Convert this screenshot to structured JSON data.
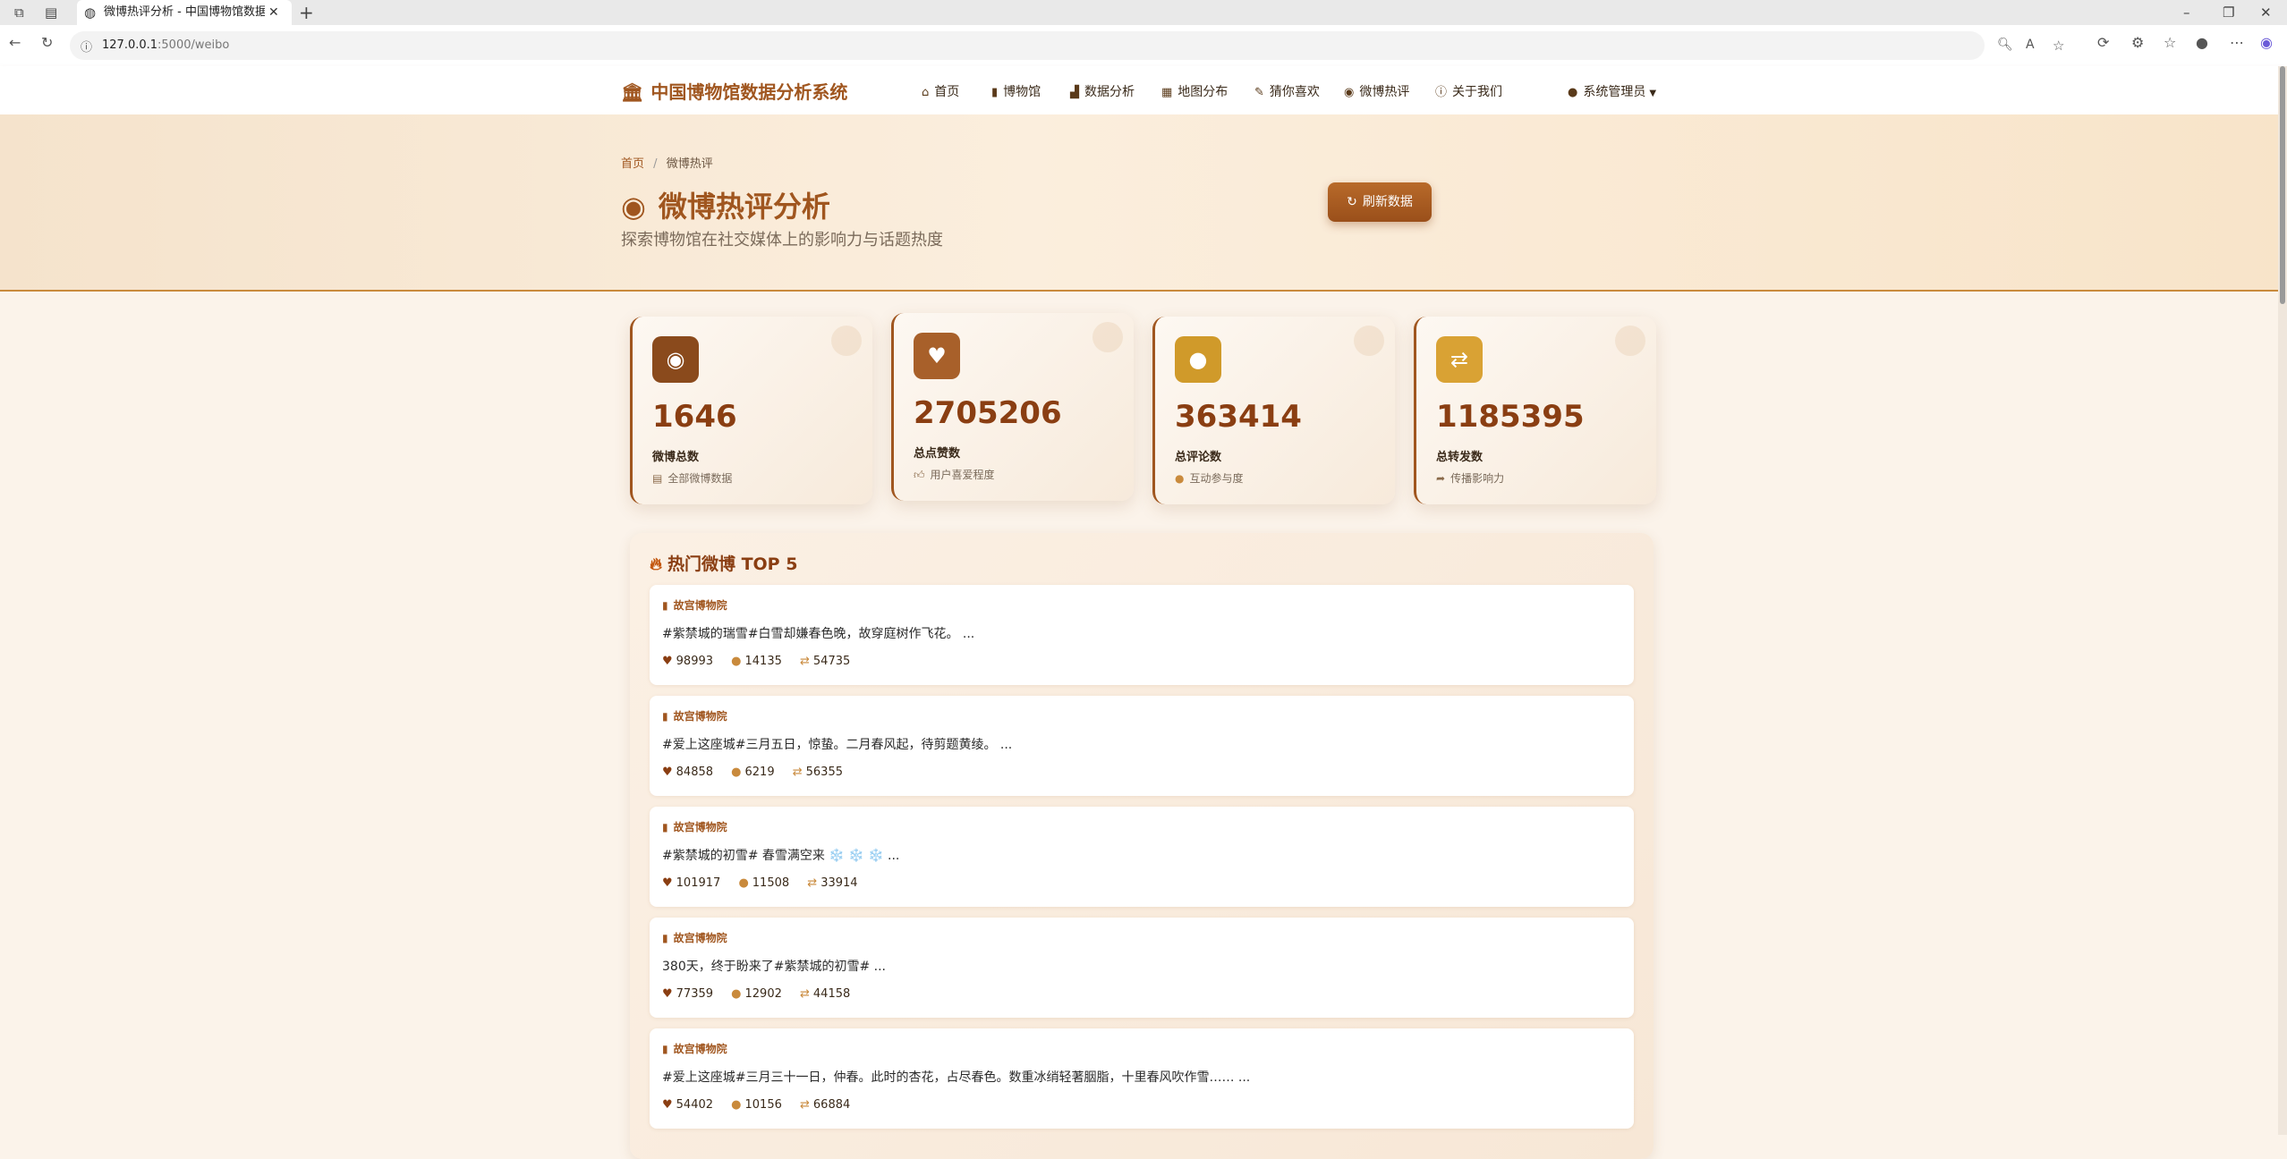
{
  "browser": {
    "tab_title": "微博热评分析 - 中国博物馆数据分析系统",
    "url_host": "127.0.0.1",
    "url_rest": ":5000/weibo"
  },
  "nav": {
    "brand": "中国博物馆数据分析系统",
    "items": [
      {
        "label": "首页",
        "icon": "home-icon"
      },
      {
        "label": "博物馆",
        "icon": "museum-icon"
      },
      {
        "label": "数据分析",
        "icon": "chart-icon"
      },
      {
        "label": "地图分布",
        "icon": "map-icon"
      },
      {
        "label": "猜你喜欢",
        "icon": "pencil-icon"
      },
      {
        "label": "微博热评",
        "icon": "weibo-icon"
      },
      {
        "label": "关于我们",
        "icon": "info-icon"
      }
    ],
    "user": "系统管理员"
  },
  "hero": {
    "breadcrumb_home": "首页",
    "breadcrumb_current": "微博热评",
    "title": "微博热评分析",
    "subtitle": "探索博物馆在社交媒体上的影响力与话题热度",
    "refresh_label": "刷新数据"
  },
  "stats": [
    {
      "value": "1646",
      "label": "微博总数",
      "note": "全部微博数据",
      "color": "#8a4a1c"
    },
    {
      "value": "2705206",
      "label": "总点赞数",
      "note": "用户喜爱程度",
      "color": "#a8602a"
    },
    {
      "value": "363414",
      "label": "总评论数",
      "note": "互动参与度",
      "color": "#d09a2a"
    },
    {
      "value": "1185395",
      "label": "总转发数",
      "note": "传播影响力",
      "color": "#d9a234"
    }
  ],
  "hot": {
    "title": "热门微博 TOP 5",
    "items": [
      {
        "source": "故宫博物院",
        "text": "#紫禁城的瑞雪#白雪却嫌春色晚，故穿庭树作飞花。 ...",
        "likes": "98993",
        "comments": "14135",
        "reposts": "54735"
      },
      {
        "source": "故宫博物院",
        "text": "#爱上这座城#三月五日，惊蛰。二月春风起，待剪题黄绫。 ...",
        "likes": "84858",
        "comments": "6219",
        "reposts": "56355"
      },
      {
        "source": "故宫博物院",
        "text": "#紫禁城的初雪# 春雪满空来 ❄️ ❄️ ❄️ ...",
        "likes": "101917",
        "comments": "11508",
        "reposts": "33914"
      },
      {
        "source": "故宫博物院",
        "text": "380天，终于盼来了#紫禁城的初雪# ...",
        "likes": "77359",
        "comments": "12902",
        "reposts": "44158"
      },
      {
        "source": "故宫博物院",
        "text": "#爱上这座城#三月三十一日，仲春。此时的杏花，占尽春色。数重冰绡轻著胭脂，十里春风吹作雪…… ...",
        "likes": "54402",
        "comments": "10156",
        "reposts": "66884"
      }
    ]
  }
}
